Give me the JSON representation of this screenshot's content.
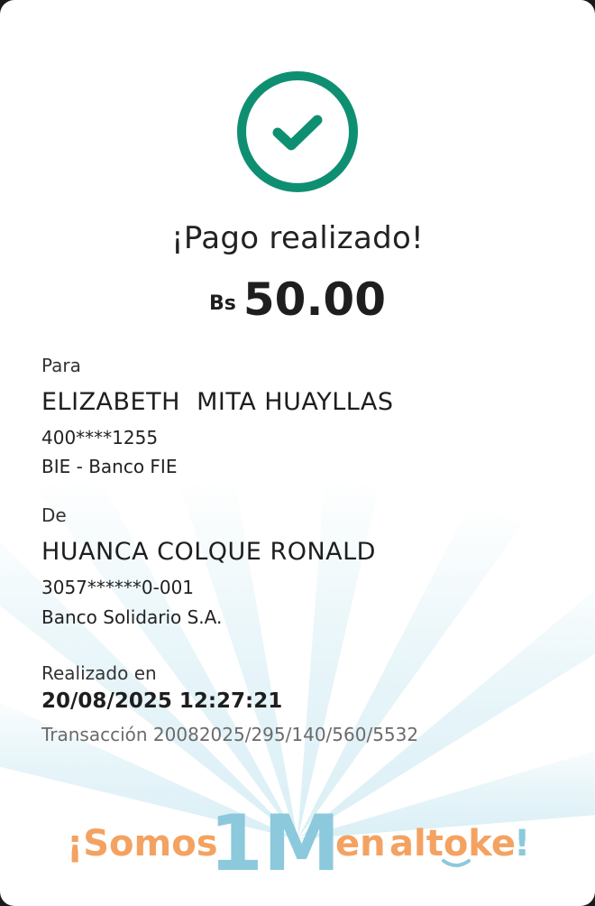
{
  "status": {
    "icon": "check-circle-icon",
    "title": "¡Pago realizado!"
  },
  "amount": {
    "currency": "Bs",
    "value": "50.00"
  },
  "recipient": {
    "label": "Para",
    "name": "ELIZABETH  MITA HUAYLLAS",
    "account": "400****1255",
    "bank": "BIE - Banco FIE"
  },
  "sender": {
    "label": "De",
    "name": "HUANCA COLQUE RONALD",
    "account": "3057******0-001",
    "bank": "Banco Solidario S.A."
  },
  "details": {
    "date_label": "Realizado en",
    "date_value": "20/08/2025 12:27:21",
    "transaction": "Transacción 20082025/295/140/560/5532"
  },
  "slogan": {
    "part1": "¡Somos",
    "highlight": "1M",
    "part2": "en",
    "brand": "altoke",
    "end": "!"
  },
  "colors": {
    "accent": "#0f8f72",
    "orange": "#f4a261",
    "blue": "#8cc9dc"
  }
}
